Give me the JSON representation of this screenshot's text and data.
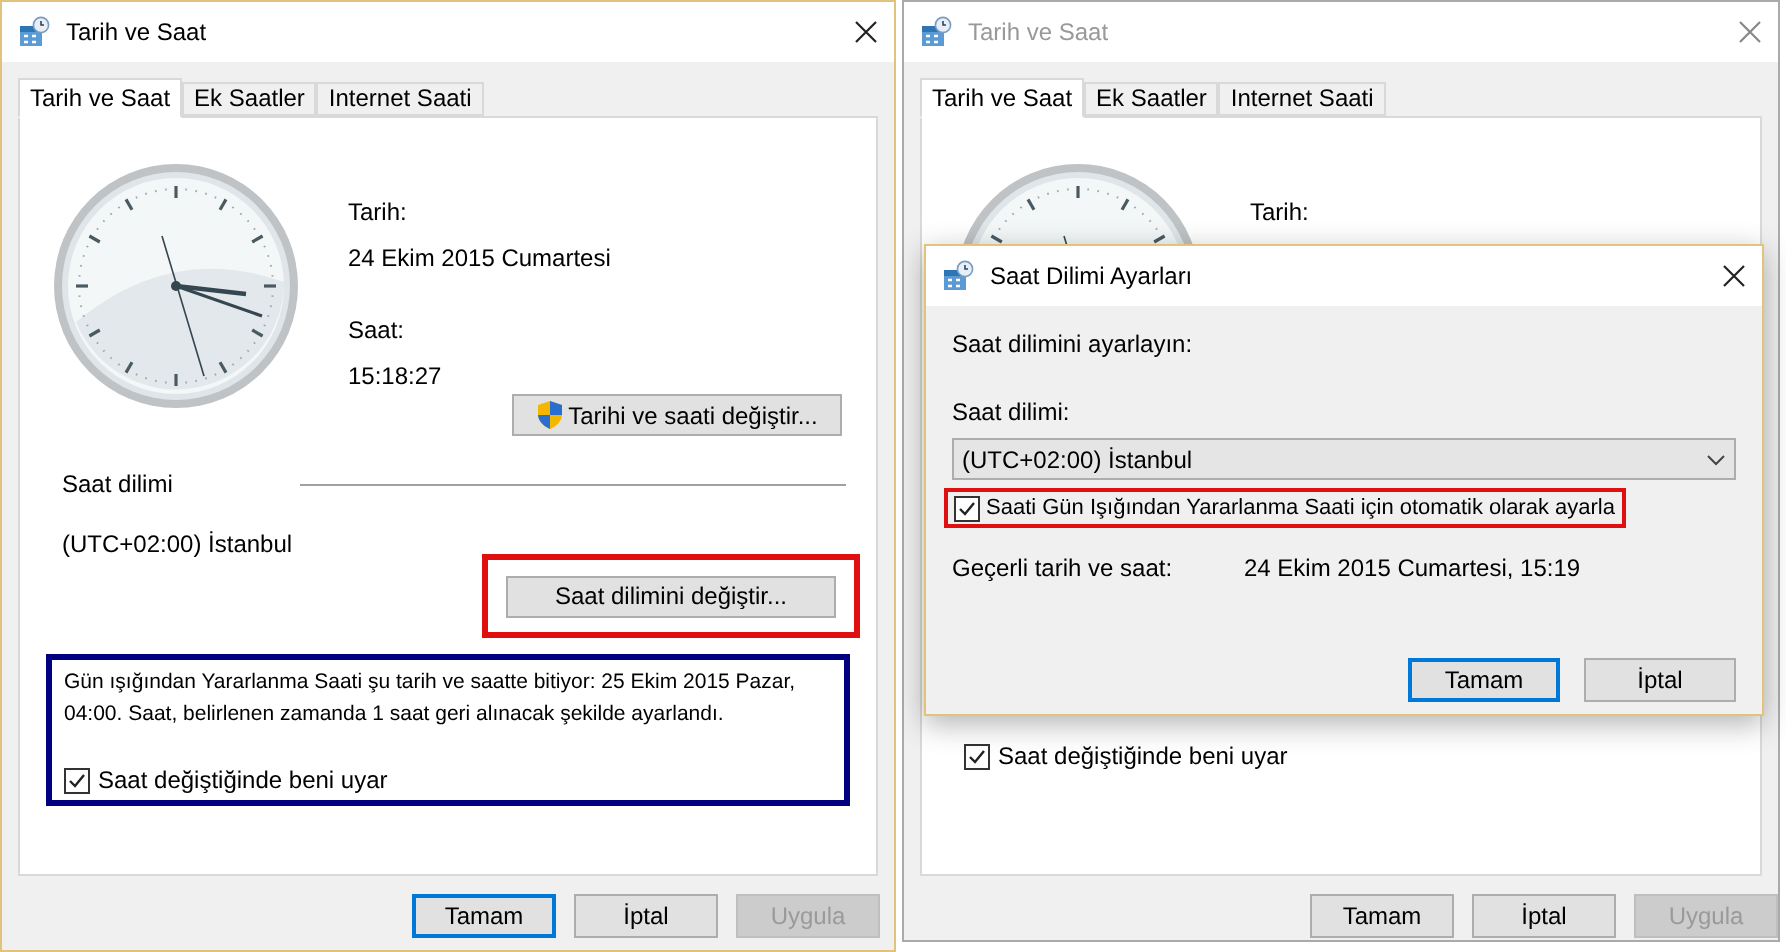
{
  "main_window": {
    "title": "Tarih ve Saat",
    "active": true,
    "tabs": [
      {
        "label": "Tarih ve Saat",
        "selected": true
      },
      {
        "label": "Ek Saatler",
        "selected": false
      },
      {
        "label": "Internet Saati",
        "selected": false
      }
    ],
    "date_label": "Tarih:",
    "date": "24 Ekim 2015 Cumartesi",
    "time_label": "Saat:",
    "time": "15:18:27",
    "change_datetime_button": "Tarihi ve saati değiştir...",
    "timezone_heading": "Saat dilimi",
    "timezone": "(UTC+02:00) İstanbul",
    "change_timezone_button": "Saat dilimini değiştir...",
    "dst_info": "Gün ışığından Yararlanma Saati şu tarih ve saatte bitiyor: 25 Ekim 2015 Pazar, 04:00. Saat, belirlenen zamanda 1 saat geri alınacak şekilde ayarlandı.",
    "notify_checkbox": {
      "label": "Saat değiştiğinde beni uyar",
      "checked": true
    },
    "buttons": [
      {
        "label": "Tamam",
        "kind": "default"
      },
      {
        "label": "İptal",
        "kind": "normal"
      },
      {
        "label": "Uygula",
        "kind": "disabled"
      }
    ]
  },
  "background_window": {
    "title": "Tarih ve Saat",
    "active": false,
    "tabs": [
      {
        "label": "Tarih ve Saat",
        "selected": true
      },
      {
        "label": "Ek Saatler",
        "selected": false
      },
      {
        "label": "Internet Saati",
        "selected": false
      }
    ],
    "date_label": "Tarih:",
    "notify_checkbox": {
      "label": "Saat değiştiğinde beni uyar",
      "checked": true
    },
    "buttons": [
      {
        "label": "Tamam",
        "kind": "normal"
      },
      {
        "label": "İptal",
        "kind": "normal"
      },
      {
        "label": "Uygula",
        "kind": "disabled"
      }
    ]
  },
  "timezone_dialog": {
    "title": "Saat Dilimi Ayarları",
    "prompt": "Saat dilimini ayarlayın:",
    "timezone_label": "Saat dilimi:",
    "timezone_value": "(UTC+02:00) İstanbul",
    "dst_checkbox": {
      "label": "Saati Gün Işığından Yararlanma Saati için otomatik olarak ayarla",
      "checked": true
    },
    "current_label": "Geçerli tarih ve saat:",
    "current_value": "24 Ekim 2015 Cumartesi, 15:19",
    "buttons": [
      {
        "label": "Tamam",
        "kind": "default"
      },
      {
        "label": "İptal",
        "kind": "normal"
      }
    ]
  }
}
